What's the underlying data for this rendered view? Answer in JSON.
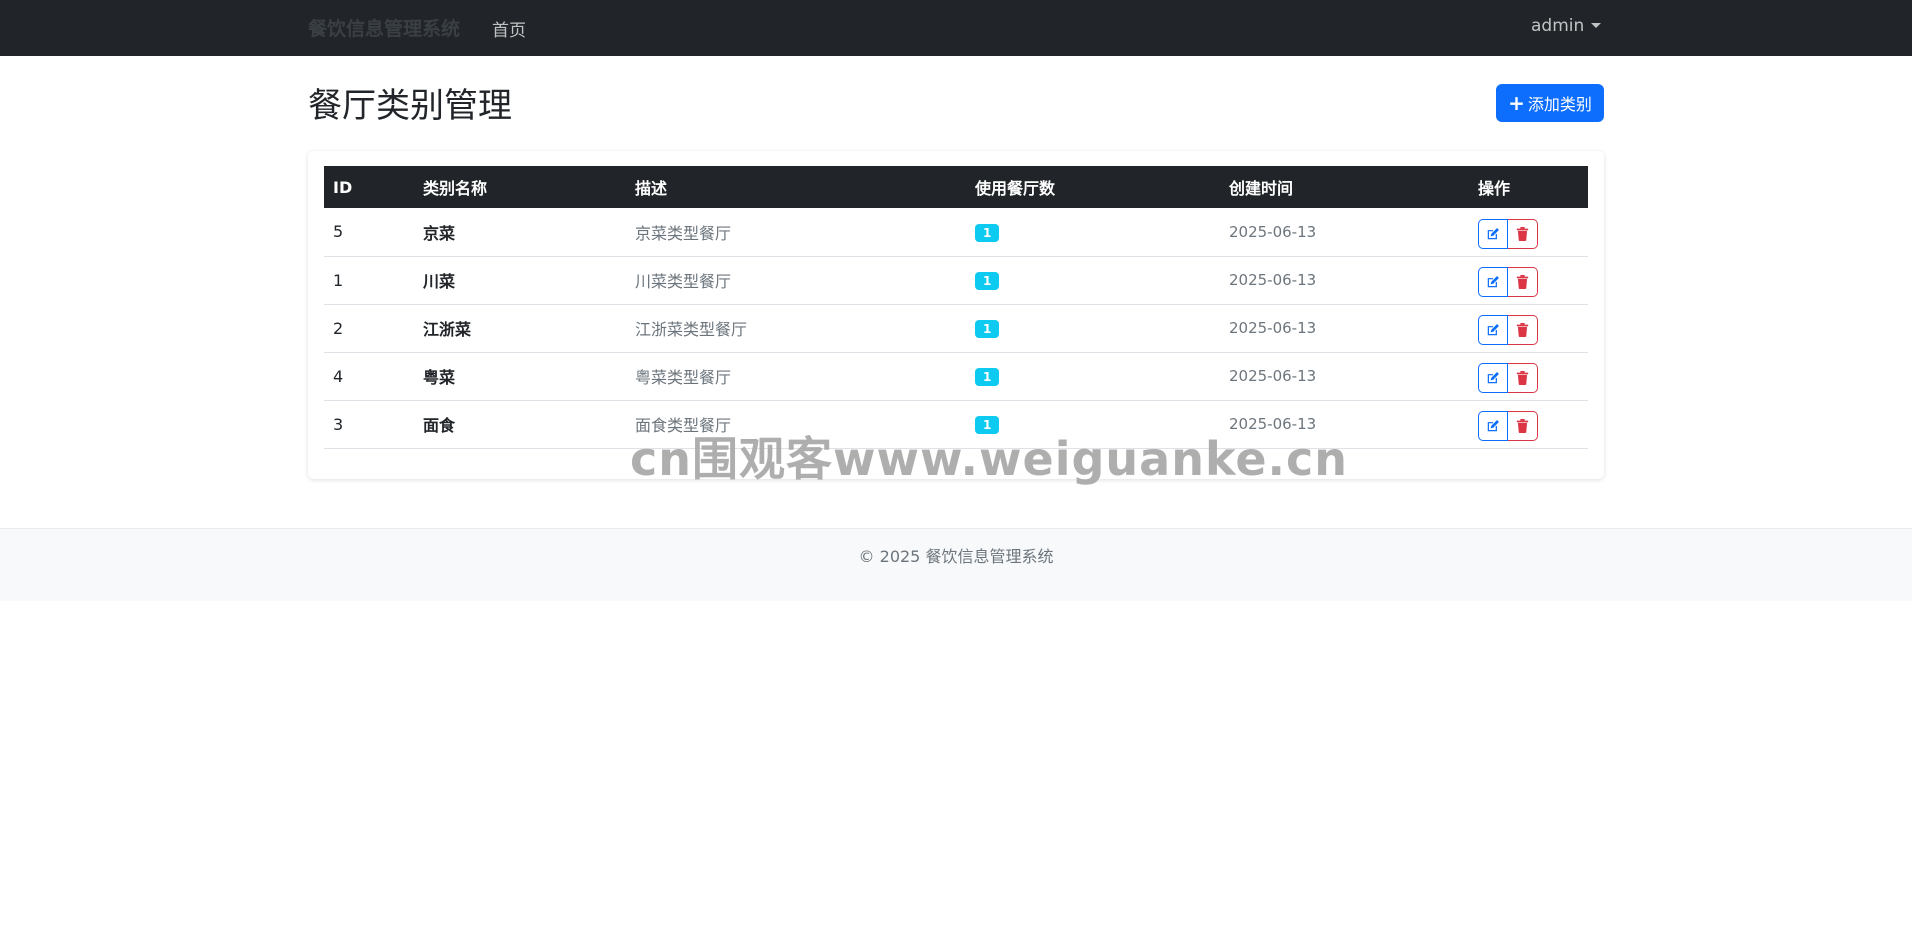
{
  "nav": {
    "brand": "餐饮信息管理系统",
    "home": "首页",
    "user": "admin"
  },
  "page": {
    "title": "餐厅类别管理",
    "add_button": "添加类别"
  },
  "table": {
    "headers": [
      "ID",
      "类别名称",
      "描述",
      "使用餐厅数",
      "创建时间",
      "操作"
    ],
    "rows": [
      {
        "id": "5",
        "name": "京菜",
        "desc": "京菜类型餐厅",
        "count": "1",
        "date": "2025-06-13"
      },
      {
        "id": "1",
        "name": "川菜",
        "desc": "川菜类型餐厅",
        "count": "1",
        "date": "2025-06-13"
      },
      {
        "id": "2",
        "name": "江浙菜",
        "desc": "江浙菜类型餐厅",
        "count": "1",
        "date": "2025-06-13"
      },
      {
        "id": "4",
        "name": "粤菜",
        "desc": "粤菜类型餐厅",
        "count": "1",
        "date": "2025-06-13"
      },
      {
        "id": "3",
        "name": "面食",
        "desc": "面食类型餐厅",
        "count": "1",
        "date": "2025-06-13"
      }
    ]
  },
  "footer": {
    "text": "© 2025 餐饮信息管理系统"
  },
  "watermark": "cn围观客www.weiguanke.cn",
  "icons": {
    "edit": "edit-icon",
    "delete": "trash-icon",
    "add": "plus-icon",
    "dropdown": "caret-down-icon"
  },
  "colors": {
    "navbar": "#212529",
    "primary": "#0d6efd",
    "danger": "#dc3545",
    "badge": "#0dcaf0"
  }
}
